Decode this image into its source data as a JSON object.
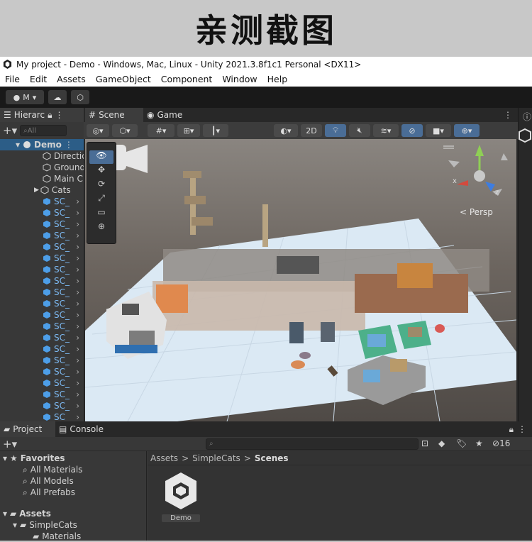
{
  "banner": {
    "title": "亲测截图"
  },
  "window": {
    "title": "My project - Demo - Windows, Mac, Linux - Unity 2021.3.8f1c1 Personal <DX11>"
  },
  "menu": [
    "File",
    "Edit",
    "Assets",
    "GameObject",
    "Component",
    "Window",
    "Help"
  ],
  "toolbar": {
    "account_label": "M"
  },
  "hierarchy": {
    "tab_label": "Hierarc",
    "search_placeholder": "All",
    "scene_name": "Demo",
    "items": [
      "Directio",
      "Ground",
      "Main C",
      "Cats"
    ],
    "scene_objects": [
      "SC_",
      "SC_",
      "SC_",
      "SC_",
      "SC_",
      "SC_",
      "SC_",
      "SC_",
      "SC_",
      "SC_",
      "SC_",
      "SC_",
      "SC_",
      "SC_",
      "SC_",
      "SC_",
      "SC_",
      "SC_",
      "SC_",
      "SC_",
      "SC_"
    ]
  },
  "scene": {
    "tab_scene": "Scene",
    "tab_game": "Game",
    "mode_2d": "2D",
    "persp_label": "Persp",
    "axis_x": "x",
    "axis_z": "z"
  },
  "project": {
    "tab_project": "Project",
    "tab_console": "Console",
    "hidden_count": "16",
    "favorites_label": "Favorites",
    "favorites": [
      "All Materials",
      "All Models",
      "All Prefabs"
    ],
    "assets_label": "Assets",
    "asset_tree": [
      "SimpleCats",
      "Materials"
    ],
    "breadcrumb": [
      "Assets",
      "SimpleCats",
      "Scenes"
    ],
    "files": [
      {
        "name": "Demo",
        "icon": "unity-scene-icon"
      }
    ]
  },
  "colors": {
    "accent": "#4a6d96",
    "dark_bg": "#383838",
    "scene_ground": "#dde8f2"
  }
}
